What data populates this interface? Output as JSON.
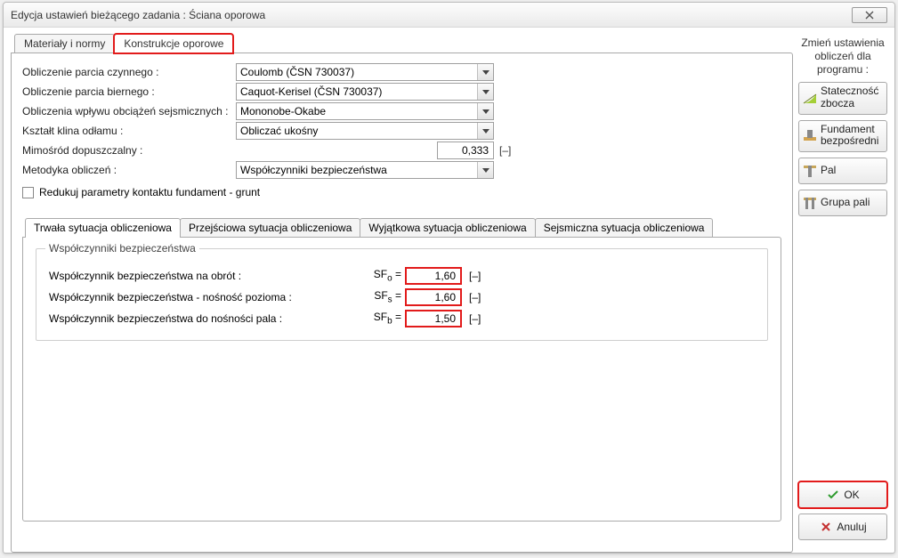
{
  "title": "Edycja ustawień bieżącego zadania : Ściana oporowa",
  "topTabs": {
    "t0": "Materiały i normy",
    "t1": "Konstrukcje oporowe"
  },
  "form": {
    "active_label": "Obliczenie parcia czynnego :",
    "active_value": "Coulomb (ČSN 730037)",
    "passive_label": "Obliczenie parcia biernego :",
    "passive_value": "Caquot-Kerisel (ČSN 730037)",
    "seismic_label": "Obliczenia wpływu obciążeń sejsmicznych :",
    "seismic_value": "Mononobe-Okabe",
    "wedge_label": "Kształt klina odłamu :",
    "wedge_value": "Obliczać ukośny",
    "ecc_label": "Mimośród dopuszczalny :",
    "ecc_value": "0,333",
    "ecc_unit": "[–]",
    "method_label": "Metodyka obliczeń :",
    "method_value": "Współczynniki bezpieczeństwa",
    "reduce_label": "Redukuj parametry kontaktu fundament - grunt"
  },
  "innerTabs": {
    "t0": "Trwała sytuacja obliczeniowa",
    "t1": "Przejściowa sytuacja obliczeniowa",
    "t2": "Wyjątkowa sytuacja obliczeniowa",
    "t3": "Sejsmiczna sytuacja obliczeniowa"
  },
  "group_legend": "Współczynniki bezpieczeństwa",
  "sf": {
    "r0": {
      "label": "Współczynnik bezpieczeństwa na obrót :",
      "sym": "SFₒ =",
      "value": "1,60",
      "unit": "[–]"
    },
    "r1": {
      "label": "Współczynnik bezpieczeństwa - nośność pozioma :",
      "sym": "SFₛ =",
      "value": "1,60",
      "unit": "[–]"
    },
    "r2": {
      "label": "Współczynnik bezpieczeństwa do nośności pala :",
      "sym": "SF_b =",
      "value": "1,50",
      "unit": "[–]"
    }
  },
  "sidebar": {
    "title": "Zmień ustawienia obliczeń dla programu :",
    "b0": "Stateczność zbocza",
    "b1": "Fundament bezpośredni",
    "b2": "Pal",
    "b3": "Grupa pali",
    "ok": "OK",
    "cancel": "Anuluj"
  }
}
